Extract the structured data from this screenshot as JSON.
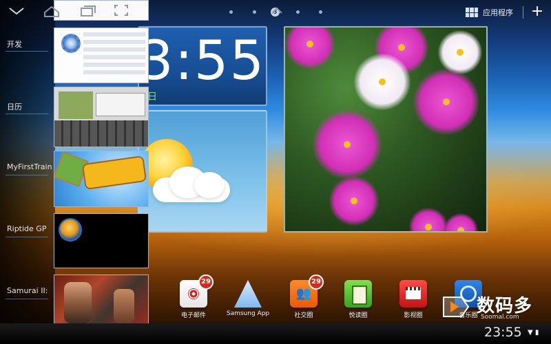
{
  "pager": {
    "current_page": "3"
  },
  "topbar": {
    "apps_label": "应用程序",
    "add_symbol": "+"
  },
  "clock_widget": {
    "time": "3:55",
    "date_fragment": "日"
  },
  "recent_apps": [
    {
      "label": "开发"
    },
    {
      "label": "日历"
    },
    {
      "label": "MyFirstTrain"
    },
    {
      "label": "Riptide GP"
    },
    {
      "label": "Samurai II:"
    }
  ],
  "dock": [
    {
      "label": "电子邮件",
      "badge": "29"
    },
    {
      "label": "Samsung App"
    },
    {
      "label": "社交圈",
      "badge": "29"
    },
    {
      "label": "悦读圈"
    },
    {
      "label": "影视圈"
    },
    {
      "label": "音乐圈"
    }
  ],
  "watermark": {
    "title": "数码多",
    "url": "Soomal.com"
  },
  "statusbar": {
    "time": "23:55"
  },
  "colors": {
    "badge_red": "#d32a1c",
    "clock_date_green": "#7ee27a",
    "widget_blue": "#1f5fae"
  }
}
